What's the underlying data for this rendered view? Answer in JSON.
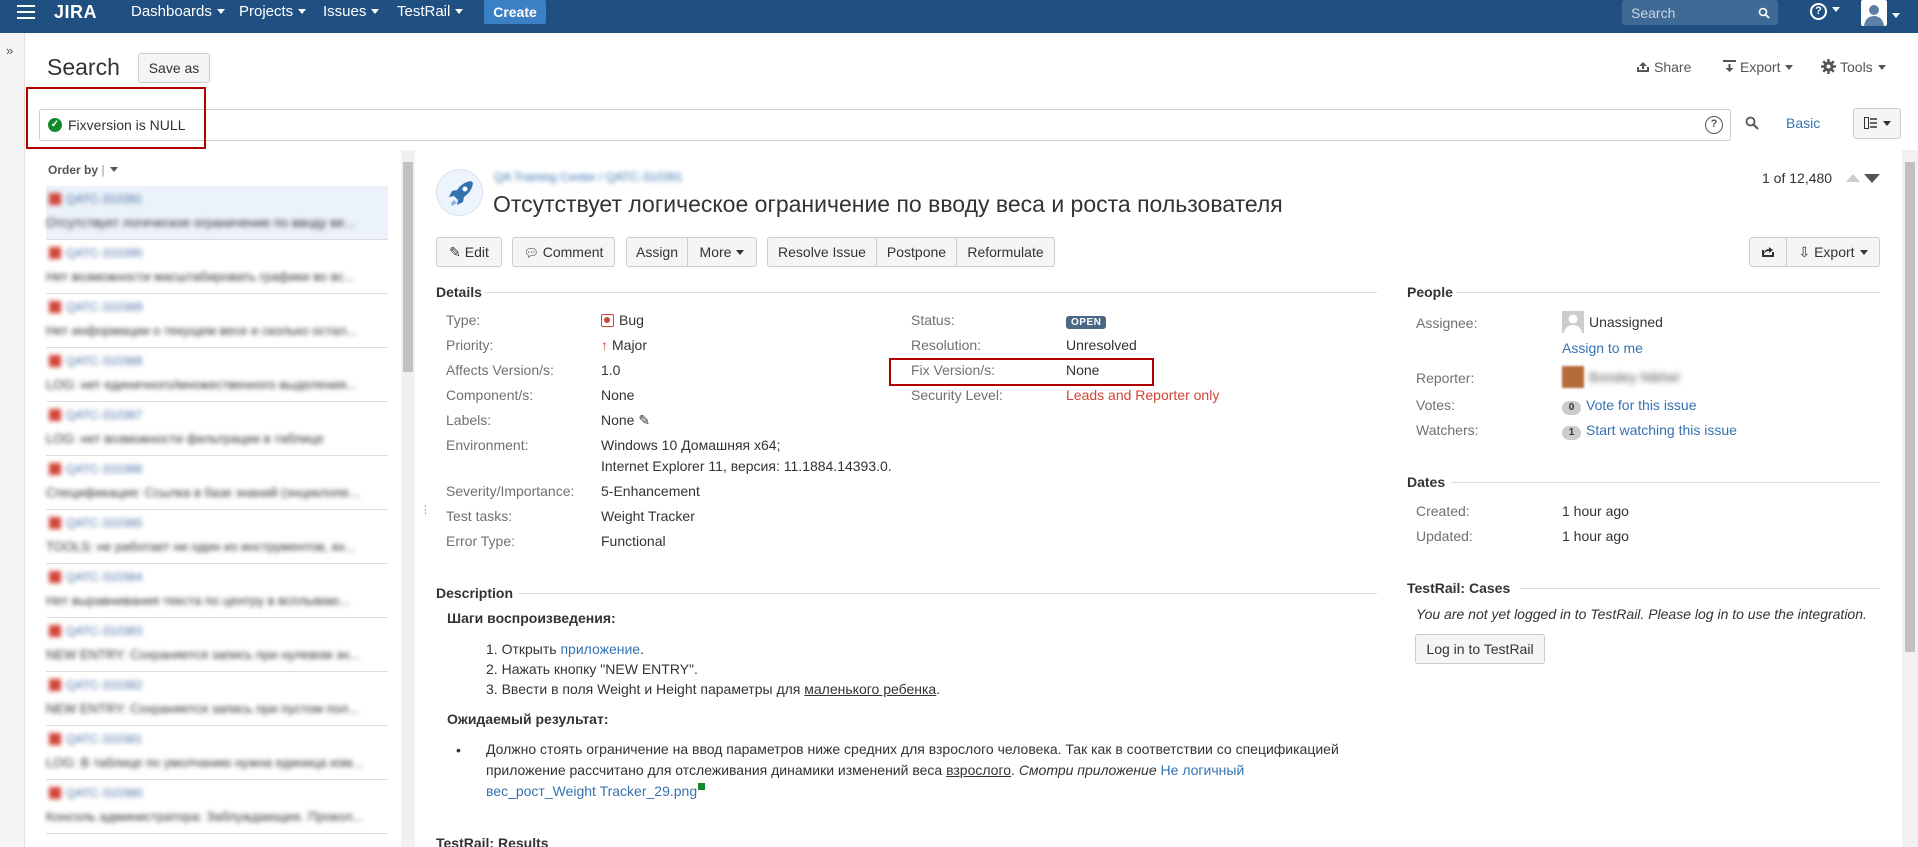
{
  "topbar": {
    "logo": "JIRA",
    "nav": [
      "Dashboards",
      "Projects",
      "Issues",
      "TestRail"
    ],
    "create_label": "Create",
    "search_placeholder": "Search"
  },
  "page": {
    "title": "Search",
    "save_as": "Save as",
    "share": "Share",
    "export": "Export",
    "tools": "Tools"
  },
  "query": {
    "text": "Fixversion is NULL",
    "basic": "Basic"
  },
  "list": {
    "order_by": "Order by",
    "items": [
      {
        "key": "QATC-310391",
        "summary": "Отсутствует логическое ограничение по вводу ве..."
      },
      {
        "key": "QATC-310390",
        "summary": "Нет возможности масштабировать графики во вс..."
      },
      {
        "key": "QATC-310389",
        "summary": "Нет информации о текущем весе и сколько остал..."
      },
      {
        "key": "QATC-310388",
        "summary": "LOG: нет единичного/множественного выделения..."
      },
      {
        "key": "QATC-310387",
        "summary": "LOG: нет возможности фильтрации в таблице"
      },
      {
        "key": "QATC-310386",
        "summary": "Спецификация: Ссылка в базе знаний (энциклопе..."
      },
      {
        "key": "QATC-310385",
        "summary": "TOOLS: не работает ни один из инструментов, кн..."
      },
      {
        "key": "QATC-310384",
        "summary": "Нет выравнивания текста по центру в всплываю..."
      },
      {
        "key": "QATC-310383",
        "summary": "NEW ENTRY: Сохраняется запись при нулевом зн..."
      },
      {
        "key": "QATC-310382",
        "summary": "NEW ENTRY: Сохраняется запись при пустом пол..."
      },
      {
        "key": "QATC-310381",
        "summary": "LOG: В таблице по умолчанию нужна единица изм..."
      },
      {
        "key": "QATC-310380",
        "summary": "Консоль администратора: Заблуждающее. Прокол..."
      }
    ]
  },
  "issue": {
    "breadcrumb": "QA Training Center  /  QATC-310391",
    "title": "Отсутствует логическое ограничение по вводу веса и роста пользователя",
    "pager": "1 of 12,480",
    "buttons": {
      "edit": "Edit",
      "comment": "Comment",
      "assign": "Assign",
      "more": "More",
      "resolve": "Resolve Issue",
      "postpone": "Postpone",
      "reformulate": "Reformulate",
      "export": "Export"
    },
    "details": {
      "heading": "Details",
      "type_label": "Type:",
      "type": "Bug",
      "priority_label": "Priority:",
      "priority": "Major",
      "affects_label": "Affects Version/s:",
      "affects": "1.0",
      "component_label": "Component/s:",
      "component": "None",
      "labels_label": "Labels:",
      "labels": "None",
      "env_label": "Environment:",
      "env1": "Windows 10 Домашняя x64;",
      "env2": "Internet Explorer 11, версия: 11.1884.14393.0.",
      "severity_label": "Severity/Importance:",
      "severity": "5-Enhancement",
      "testtasks_label": "Test tasks:",
      "testtasks": "Weight Tracker",
      "errortype_label": "Error Type:",
      "errortype": "Functional",
      "status_label": "Status:",
      "status": "OPEN",
      "resolution_label": "Resolution:",
      "resolution": "Unresolved",
      "fixversion_label": "Fix Version/s:",
      "fixversion": "None",
      "security_label": "Security Level:",
      "security": "Leads and Reporter only"
    },
    "description": {
      "heading": "Description",
      "steps_title": "Шаги воспроизведения:",
      "step1_a": "Открыть ",
      "step1_link": "приложение",
      "step1_b": ".",
      "step2": "Нажать кнопку \"NEW ENTRY\".",
      "step3_a": "Ввести в поля Weight и Height параметры для ",
      "step3_u": "маленького ребенка",
      "step3_b": ".",
      "expected_title": "Ожидаемый результат:",
      "exp1": "Должно стоять ограничение на ввод параметров ниже средних для взрослого человека. Так как в соответствии со спецификацией",
      "exp2_a": "приложение рассчитано для отслеживания динамики изменений веса ",
      "exp2_u": "взрослого",
      "exp2_b": ". ",
      "exp2_i": "Смотри приложение",
      "exp2_link": " Не логичный",
      "exp3_link": "вес_рост_Weight Tracker_29.png"
    },
    "testrail_results_heading": "TestRail: Results"
  },
  "people": {
    "heading": "People",
    "assignee_label": "Assignee:",
    "assignee": "Unassigned",
    "assign_to_me": "Assign to me",
    "reporter_label": "Reporter:",
    "reporter": "Bondey Nikhel",
    "votes_label": "Votes:",
    "votes_count": "0",
    "vote_link": "Vote for this issue",
    "watchers_label": "Watchers:",
    "watchers_count": "1",
    "watch_link": "Start watching this issue"
  },
  "dates": {
    "heading": "Dates",
    "created_label": "Created:",
    "created": "1 hour ago",
    "updated_label": "Updated:",
    "updated": "1 hour ago"
  },
  "testrail": {
    "heading": "TestRail: Cases",
    "note": "You are not yet logged in to TestRail. Please log in to use the integration.",
    "login": "Log in to TestRail"
  },
  "colors": {
    "topbar": "#205081",
    "link": "#3572b0",
    "bug": "#d04437",
    "highlight": "#b10000"
  }
}
